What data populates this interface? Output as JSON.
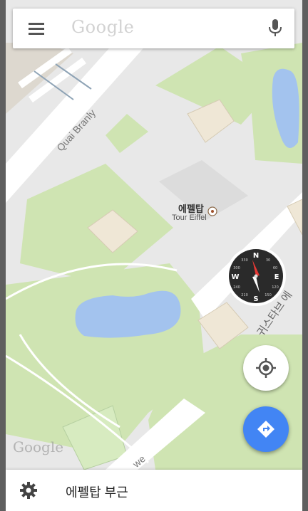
{
  "search": {
    "placeholder_logo": "Google",
    "menu_icon": "hamburger-menu-icon",
    "mic_icon": "microphone-icon"
  },
  "map": {
    "poi_name_ko": "에펠탑",
    "poi_name_en": "Tour Eiffel",
    "road_quai_branly": "Quai Branly",
    "road_rue_korean": "귀스타브 에",
    "road_avenue_fragment": "we",
    "watermark": "Google",
    "colors": {
      "park": "#cfe4b2",
      "road": "#ffffff",
      "plaza": "#e6e6e6",
      "water": "#a3c3ee",
      "building": "#efe7d6"
    }
  },
  "compass": {
    "labels": [
      "N",
      "E",
      "S",
      "W"
    ],
    "degree_labels": [
      "30",
      "60",
      "120",
      "150",
      "210",
      "240",
      "300",
      "330"
    ]
  },
  "controls": {
    "locate_icon": "my-location-icon",
    "directions_icon": "directions-icon",
    "directions_color": "#4285f4"
  },
  "bottom_bar": {
    "settings_icon": "gear-icon",
    "label": "에펠탑 부근"
  }
}
